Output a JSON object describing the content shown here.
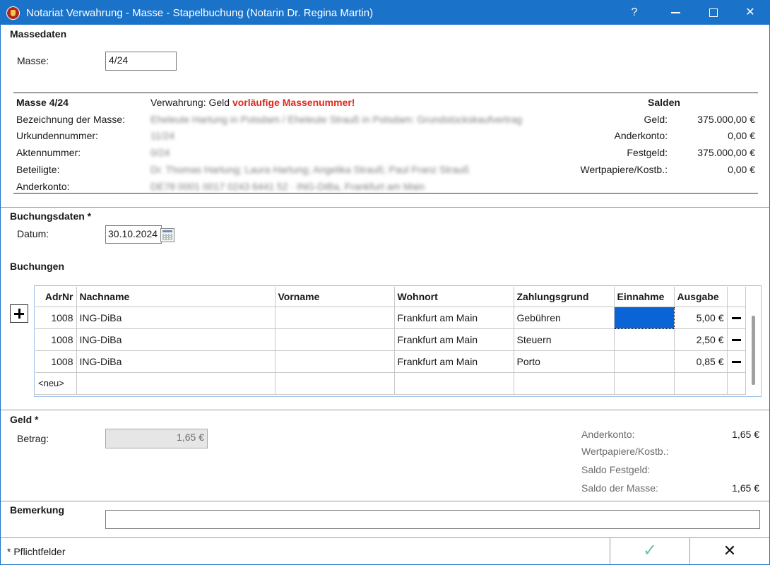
{
  "window": {
    "title": "Notariat Verwahrung - Masse - Stapelbuchung (Notarin Dr. Regina Martin)",
    "help": "?",
    "close": "✕"
  },
  "massedaten": {
    "section_title": "Massedaten",
    "masse_label": "Masse:",
    "masse_value": "4/24"
  },
  "masse_info": {
    "header": "Masse 4/24",
    "verwahrung_label": "Verwahrung: Geld",
    "warning": "vorläufige Massenummer!",
    "rows": [
      {
        "label": "Bezeichnung der Masse:",
        "value": "Eheleute Hartung in Potsdam / Eheleute Strauß in Potsdam: Grundstückskaufvertrag"
      },
      {
        "label": "Urkundennummer:",
        "value": "11/24"
      },
      {
        "label": "Aktennummer:",
        "value": "0/24"
      },
      {
        "label": "Beteiligte:",
        "value": "Dr. Thomas Hartung; Laura Hartung; Angelika Strauß; Paul Franz Strauß"
      },
      {
        "label": "Anderkonto:",
        "value": "DE78 0001 0017 0243 6441 52 · ING-DiBa, Frankfurt am Main"
      }
    ],
    "salden_title": "Salden",
    "salden": [
      {
        "label": "Geld:",
        "value": "375.000,00 €"
      },
      {
        "label": "Anderkonto:",
        "value": "0,00 €"
      },
      {
        "label": "Festgeld:",
        "value": "375.000,00 €"
      },
      {
        "label": "Wertpapiere/Kostb.:",
        "value": "0,00 €"
      }
    ]
  },
  "buchungsdaten": {
    "section_title": "Buchungsdaten *",
    "datum_label": "Datum:",
    "datum_value": "30.10.2024"
  },
  "buchungen": {
    "section_title": "Buchungen",
    "columns": [
      "AdrNr",
      "Nachname",
      "Vorname",
      "Wohnort",
      "Zahlungsgrund",
      "Einnahme",
      "Ausgabe"
    ],
    "rows": [
      {
        "adrnr": "1008",
        "nachname": "ING-DiBa",
        "vorname": "",
        "wohnort": "Frankfurt am Main",
        "zahlungsgrund": "Gebühren",
        "einnahme": "",
        "ausgabe": "5,00 €"
      },
      {
        "adrnr": "1008",
        "nachname": "ING-DiBa",
        "vorname": "",
        "wohnort": "Frankfurt am Main",
        "zahlungsgrund": "Steuern",
        "einnahme": "",
        "ausgabe": "2,50 €"
      },
      {
        "adrnr": "1008",
        "nachname": "ING-DiBa",
        "vorname": "",
        "wohnort": "Frankfurt am Main",
        "zahlungsgrund": "Porto",
        "einnahme": "",
        "ausgabe": "0,85 €"
      }
    ],
    "new_row_label": "<neu>"
  },
  "geld": {
    "section_title": "Geld *",
    "betrag_label": "Betrag:",
    "betrag_value": "1,65 €",
    "summary": [
      {
        "label": "Anderkonto:",
        "value": "1,65 €"
      },
      {
        "label": "Wertpapiere/Kostb.:",
        "value": ""
      },
      {
        "label": "Saldo Festgeld:",
        "value": ""
      },
      {
        "label": "Saldo der Masse:",
        "value": "1,65 €"
      }
    ]
  },
  "bemerkung": {
    "section_title": "Bemerkung",
    "value": ""
  },
  "footer": {
    "pflicht": "* Pflichtfelder",
    "ok": "✓",
    "cancel": "✕"
  },
  "colors": {
    "titlebar": "#1a73c9",
    "warning": "#e0261c",
    "selection": "#0a64d6"
  }
}
